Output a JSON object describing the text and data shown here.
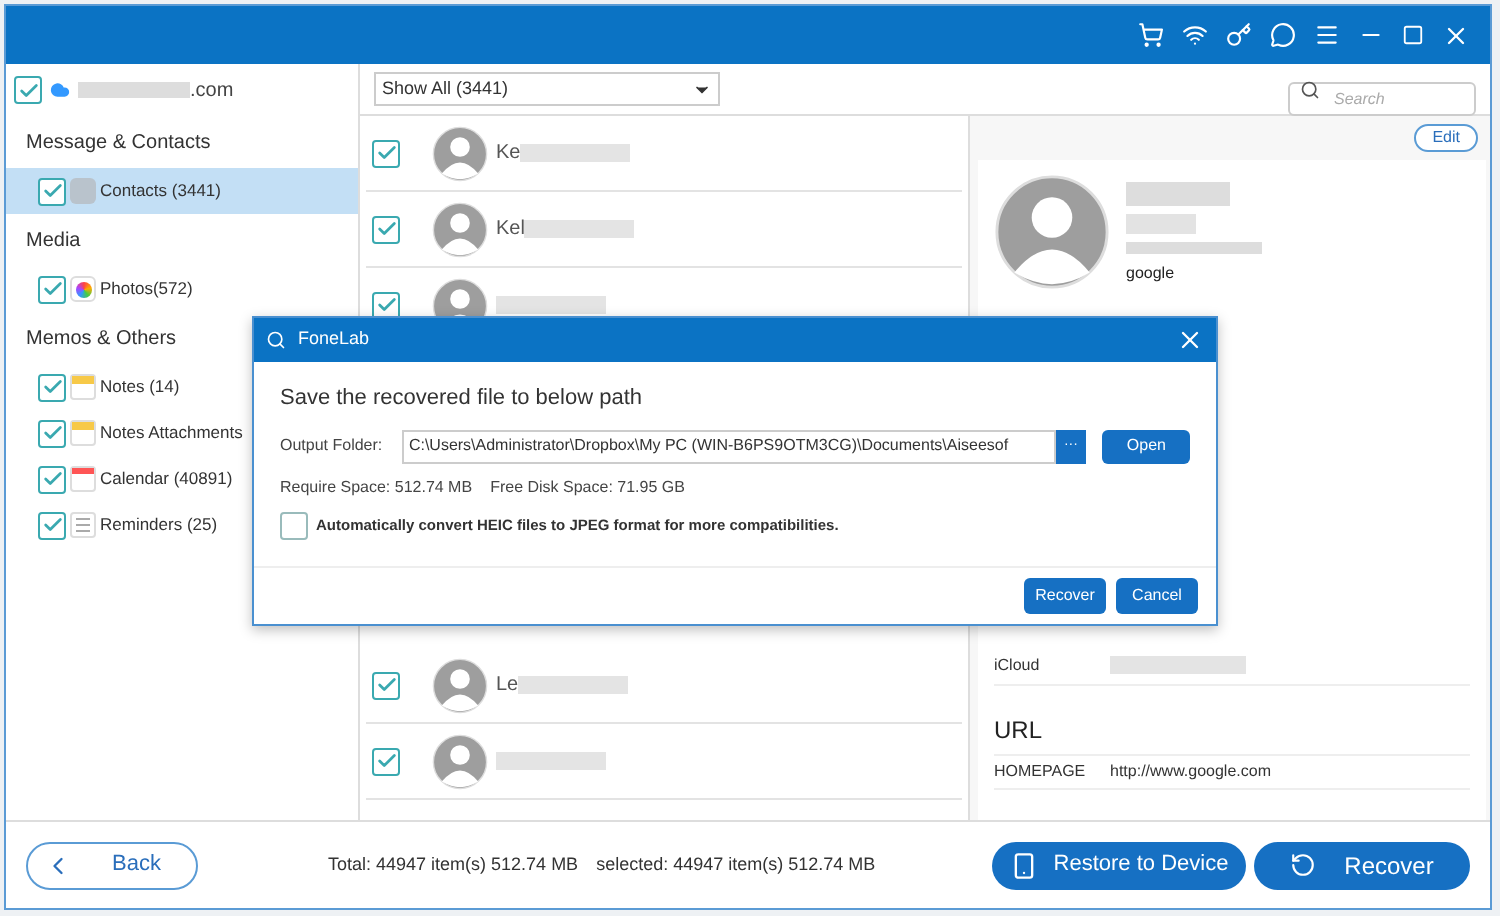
{
  "account": {
    "label": ".com",
    "checked": true
  },
  "sidebar": {
    "groups": [
      {
        "title": "Message & Contacts",
        "items": [
          {
            "label": "Contacts (3441)",
            "checked": true,
            "selected": true,
            "kind": "contacts"
          }
        ]
      },
      {
        "title": "Media",
        "items": [
          {
            "label": "Photos(572)",
            "checked": true,
            "selected": false,
            "kind": "photos"
          }
        ]
      },
      {
        "title": "Memos & Others",
        "items": [
          {
            "label": "Notes (14)",
            "checked": true,
            "selected": false,
            "kind": "notes"
          },
          {
            "label": "Notes Attachments",
            "checked": true,
            "selected": false,
            "kind": "notes"
          },
          {
            "label": "Calendar (40891)",
            "checked": true,
            "selected": false,
            "kind": "calendar"
          },
          {
            "label": "Reminders (25)",
            "checked": true,
            "selected": false,
            "kind": "reminders"
          }
        ]
      }
    ]
  },
  "filter": {
    "value": "Show All (3441)"
  },
  "search": {
    "placeholder": "Search"
  },
  "contacts_top": [
    {
      "name": "Ke",
      "checked": true
    },
    {
      "name": "Kel",
      "checked": true
    },
    {
      "checked": true
    }
  ],
  "contacts_bottom": [
    {
      "name": "Le",
      "checked": true
    },
    {
      "checked": true
    }
  ],
  "detail": {
    "edit": "Edit",
    "company": "google",
    "fields": [
      {
        "label": "iCloud"
      }
    ],
    "section": "URL",
    "url_fields": [
      {
        "label": "HOMEPAGE",
        "value": "http://www.google.com"
      }
    ]
  },
  "footer": {
    "back": "Back",
    "total": "Total: 44947 item(s) 512.74 MB",
    "selected": "selected: 44947 item(s) 512.74 MB",
    "restore": "Restore to Device",
    "recover": "Recover"
  },
  "dialog": {
    "title": "FoneLab",
    "heading": "Save the recovered file to below path",
    "folder_label": "Output Folder:",
    "folder_value": "C:\\Users\\Administrator\\Dropbox\\My PC (WIN-B6PS9OTM3CG)\\Documents\\Aiseesof",
    "browse": "···",
    "open": "Open",
    "require": "Require Space: 512.74 MB",
    "free": "Free Disk Space: 71.95 GB",
    "heic": {
      "label": "Automatically convert HEIC files to JPEG format for more compatibilities.",
      "checked": false
    },
    "recover": "Recover",
    "cancel": "Cancel"
  }
}
